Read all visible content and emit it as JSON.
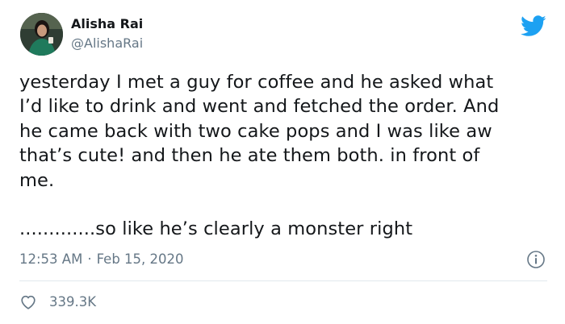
{
  "author": {
    "display_name": "Alisha Rai",
    "handle": "@AlishaRai"
  },
  "tweet": {
    "paragraph_1": "yesterday I met a guy for coffee and he asked what\nI’d like to drink and went and fetched the order. And\nhe came back with two cake pops and I was like aw\nthat’s cute! and then he ate them both. in front of\nme.",
    "paragraph_2": ".............so like he’s clearly a monster right"
  },
  "meta": {
    "time": "12:53 AM",
    "separator": "·",
    "date": "Feb 15, 2020"
  },
  "engagement": {
    "likes": "339.3K"
  },
  "colors": {
    "twitter_blue": "#1da1f2",
    "secondary_text": "#657786",
    "primary_text": "#14171a",
    "divider": "#e1e8ed"
  },
  "icons": {
    "brand": "twitter-bird-icon",
    "info": "info-icon",
    "like": "heart-icon"
  }
}
